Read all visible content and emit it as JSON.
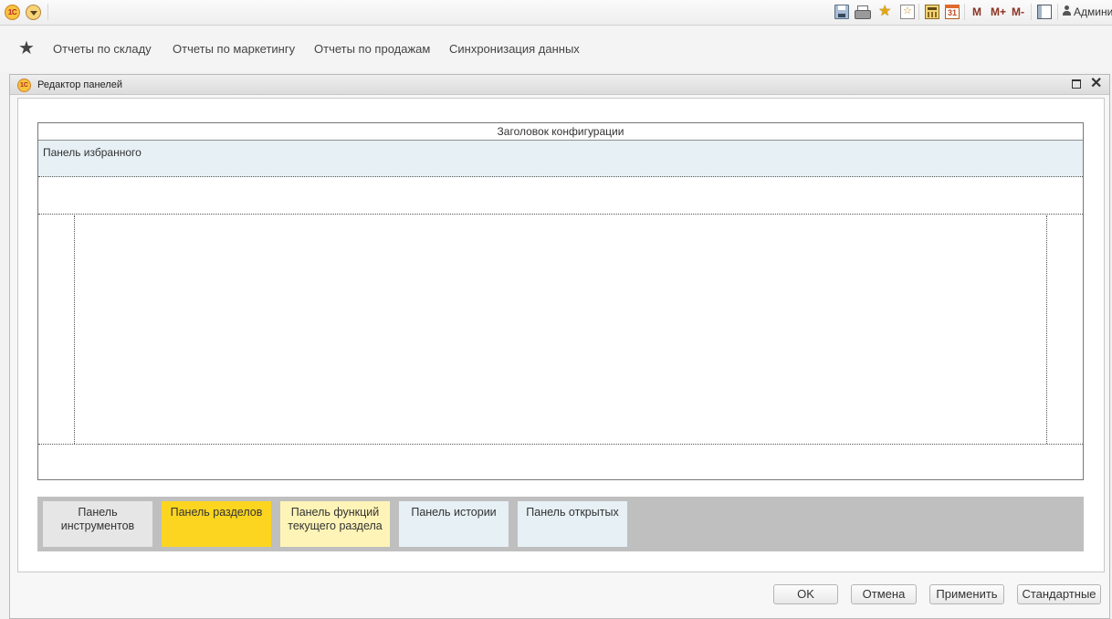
{
  "topbar": {
    "logo_text": "1С",
    "memory_buttons": [
      "M",
      "M+",
      "M-"
    ],
    "calendar_day": "31",
    "user_name": "Админис",
    "icons": [
      "app-logo-icon",
      "main-menu-icon",
      "save-icon",
      "print-icon",
      "add-favorite-icon",
      "favorites-icon",
      "calculator-icon",
      "calendar-icon",
      "panels-icon",
      "user-icon"
    ]
  },
  "sections": {
    "items": [
      {
        "label": "Отчеты по складу"
      },
      {
        "label": "Отчеты по маркетингу"
      },
      {
        "label": "Отчеты по продажам"
      },
      {
        "label": "Синхронизация данных"
      }
    ]
  },
  "modal": {
    "title": "Редактор панелей",
    "layout_header": "Заголовок конфигурации",
    "favorites_panel": "Панель избранного",
    "palette": [
      {
        "label": "Панель инструментов",
        "color": "#e6e6e6"
      },
      {
        "label": "Панель разделов",
        "color": "#fbd520"
      },
      {
        "label": "Панель функций текущего раздела",
        "color": "#fff4b7"
      },
      {
        "label": "Панель истории",
        "color": "#e6f0f5"
      },
      {
        "label": "Панель открытых",
        "color": "#e6f0f5"
      }
    ],
    "buttons": {
      "ok": "OK",
      "cancel": "Отмена",
      "apply": "Применить",
      "standard": "Стандартные"
    }
  }
}
